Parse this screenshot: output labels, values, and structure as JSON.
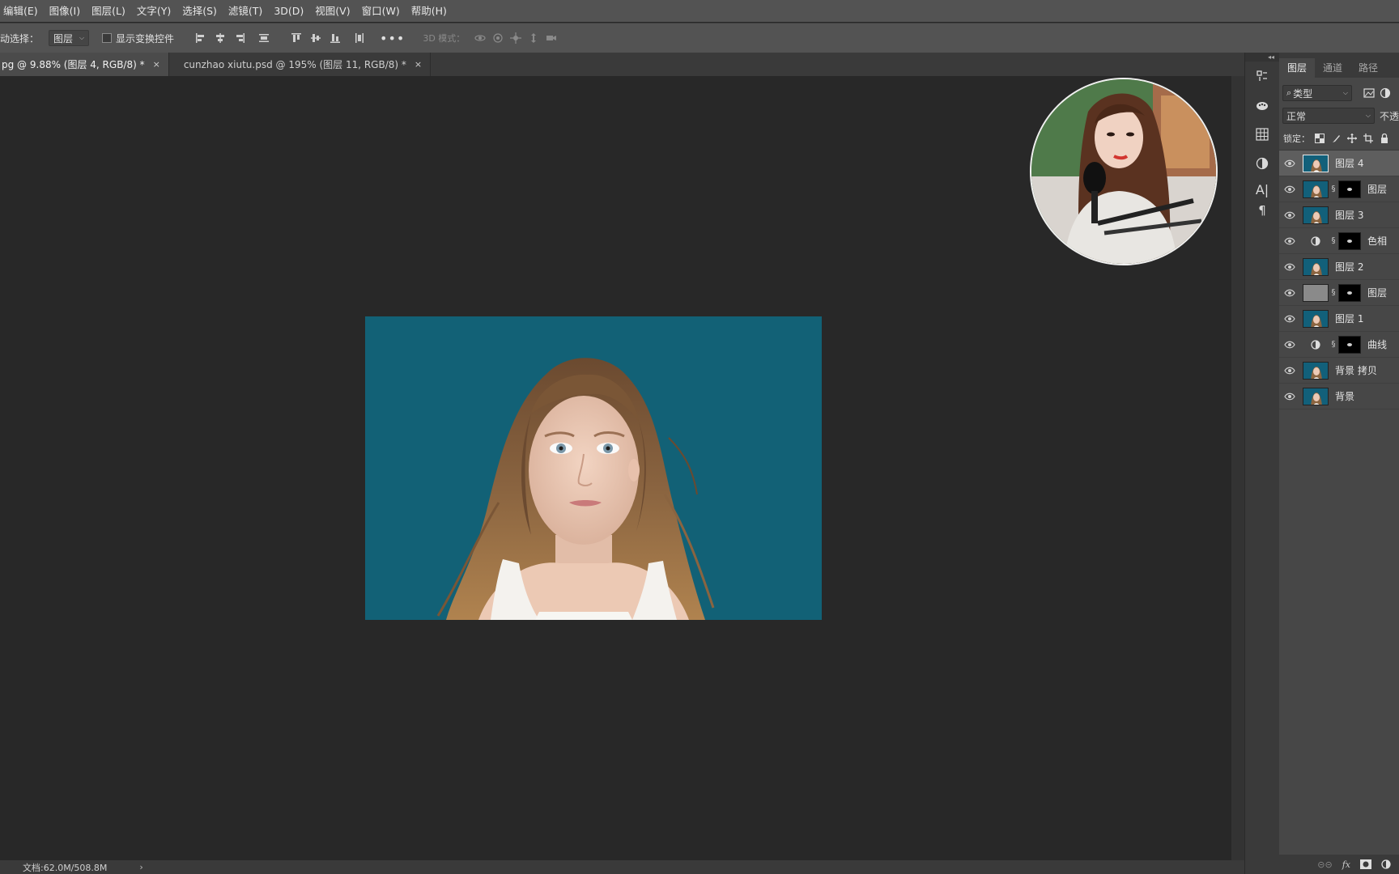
{
  "menu": [
    "编辑(E)",
    "图像(I)",
    "图层(L)",
    "文字(Y)",
    "选择(S)",
    "滤镜(T)",
    "3D(D)",
    "视图(V)",
    "窗口(W)",
    "帮助(H)"
  ],
  "options": {
    "auto_select_label": "动选择：",
    "auto_select_value": "图层",
    "show_transform_label": "显示变换控件",
    "mode_3d_label": "3D 模式："
  },
  "tabs": [
    {
      "label": "pg @ 9.88% (图层 4, RGB/8) *",
      "close": "×"
    },
    {
      "label": "cunzhao xiutu.psd @ 195% (图层 11, RGB/8) *",
      "close": "×"
    }
  ],
  "status": {
    "doc_size": "文档:62.0M/508.8M",
    "arrow": "›"
  },
  "panel": {
    "tabs": [
      "图层",
      "通道",
      "路径"
    ],
    "filter_label": "类型",
    "blend_mode": "正常",
    "opacity_label": "不透",
    "lock_label": "锁定："
  },
  "layers": [
    {
      "name": "图层 4",
      "selected": true,
      "thumb": "photo",
      "mask": false,
      "adjustment": false
    },
    {
      "name": "图层",
      "selected": false,
      "thumb": "photo",
      "mask": true,
      "adjustment": false
    },
    {
      "name": "图层 3",
      "selected": false,
      "thumb": "photo",
      "mask": false,
      "adjustment": false
    },
    {
      "name": "色相",
      "selected": false,
      "thumb": "adjust",
      "mask": true,
      "adjustment": true
    },
    {
      "name": "图层 2",
      "selected": false,
      "thumb": "photo",
      "mask": false,
      "adjustment": false
    },
    {
      "name": "图层",
      "selected": false,
      "thumb": "gray",
      "mask": true,
      "adjustment": false
    },
    {
      "name": "图层 1",
      "selected": false,
      "thumb": "photo",
      "mask": false,
      "adjustment": false
    },
    {
      "name": "曲线",
      "selected": false,
      "thumb": "adjust",
      "mask": true,
      "adjustment": true
    },
    {
      "name": "背景 拷贝",
      "selected": false,
      "thumb": "photo",
      "mask": false,
      "adjustment": false
    },
    {
      "name": "背景",
      "selected": false,
      "thumb": "photo",
      "mask": false,
      "adjustment": false
    }
  ],
  "colors": {
    "canvas_bg": "#282828",
    "image_bg": "#126176",
    "panel_bg": "#474747",
    "bar_bg": "#535353"
  }
}
